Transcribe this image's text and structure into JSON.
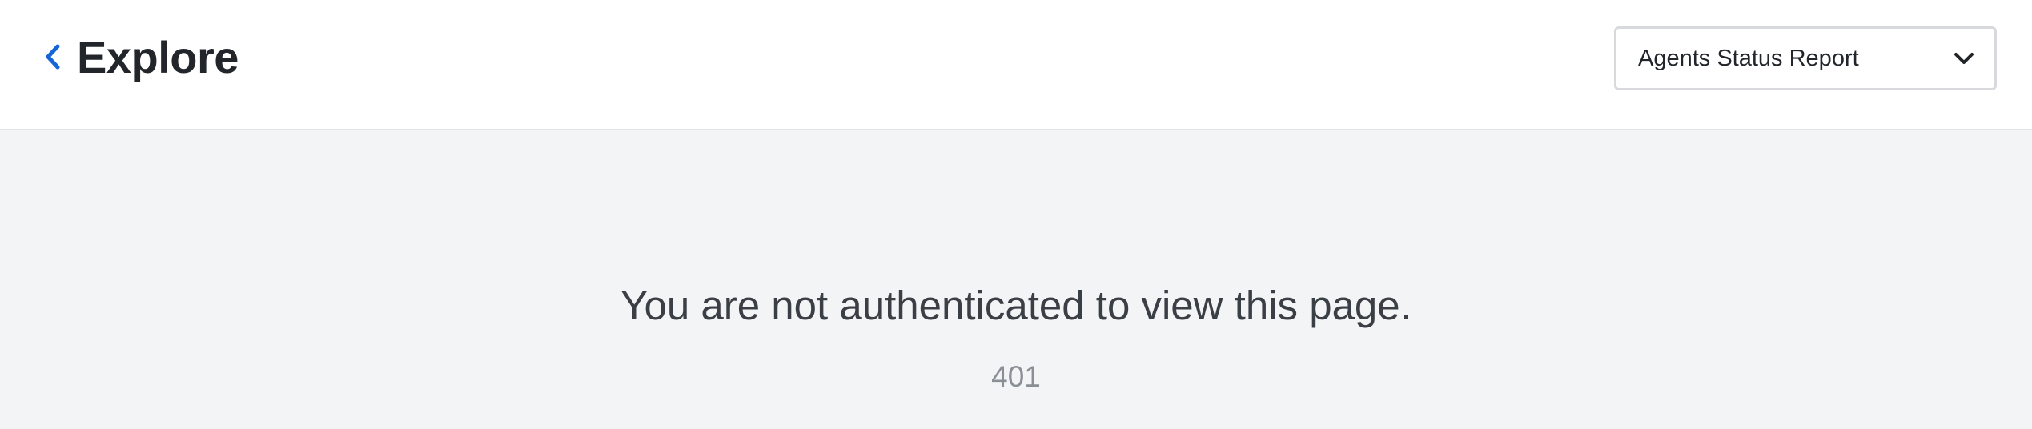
{
  "header": {
    "back_icon": "chevron-left-icon",
    "title": "Explore",
    "report_select": {
      "selected": "Agents Status Report",
      "icon": "chevron-down-icon"
    }
  },
  "main": {
    "error_message": "You are not authenticated to view this page.",
    "error_code": "401"
  },
  "colors": {
    "accent": "#1565d8",
    "header_bg": "#ffffff",
    "page_bg": "#f3f4f6"
  }
}
